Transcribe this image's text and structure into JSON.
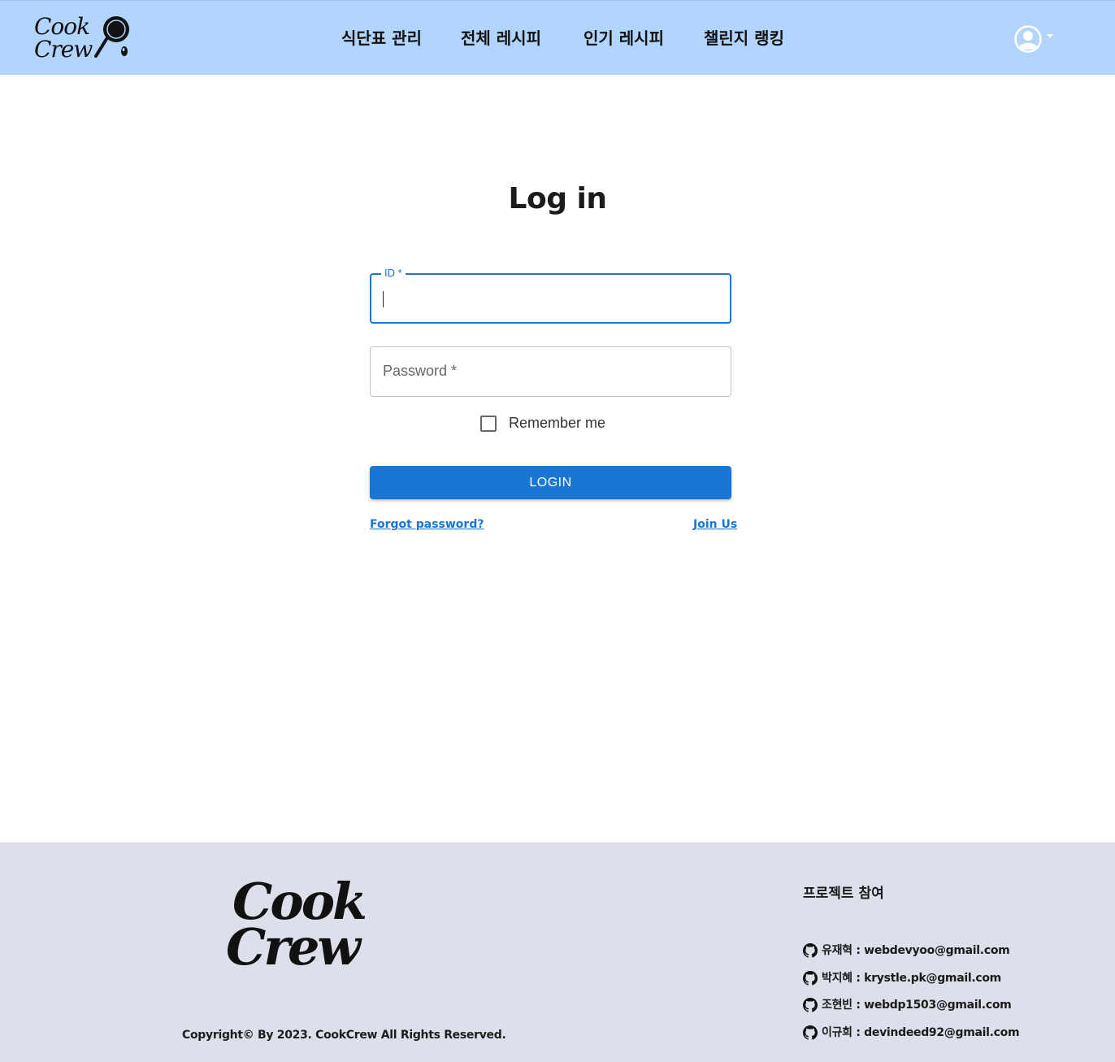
{
  "header": {
    "logo_line1": "Cook",
    "logo_line2": "Crew",
    "nav": [
      {
        "label": "식단표 관리"
      },
      {
        "label": "전체 레시피"
      },
      {
        "label": "인기 레시피"
      },
      {
        "label": "챌린지 랭킹"
      }
    ],
    "user_icon": "account-circle-icon"
  },
  "login": {
    "title": "Log in",
    "id_label": "ID *",
    "id_value": "",
    "password_placeholder": "Password *",
    "remember_label": "Remember me",
    "remember_checked": false,
    "login_button": "LOGIN",
    "forgot_link": "Forgot password?",
    "join_link": "Join Us"
  },
  "footer": {
    "logo_line1": "Cook",
    "logo_line2": "Crew",
    "copyright": "Copyright© By 2023. CookCrew All Rights Reserved.",
    "contributors_title": "프로젝트 참여",
    "contributors": [
      {
        "text": "유재혁 : webdevyoo@gmail.com",
        "icon": "github-icon"
      },
      {
        "text": "박지혜 : krystle.pk@gmail.com",
        "icon": "github-icon"
      },
      {
        "text": "조현빈 : webdp1503@gmail.com",
        "icon": "github-icon"
      },
      {
        "text": "이규희 : devindeed92@gmail.com",
        "icon": "github-icon"
      }
    ]
  },
  "colors": {
    "header_bg": "#b1d5fd",
    "primary": "#1976d2",
    "footer_bg": "#dde0ea"
  }
}
